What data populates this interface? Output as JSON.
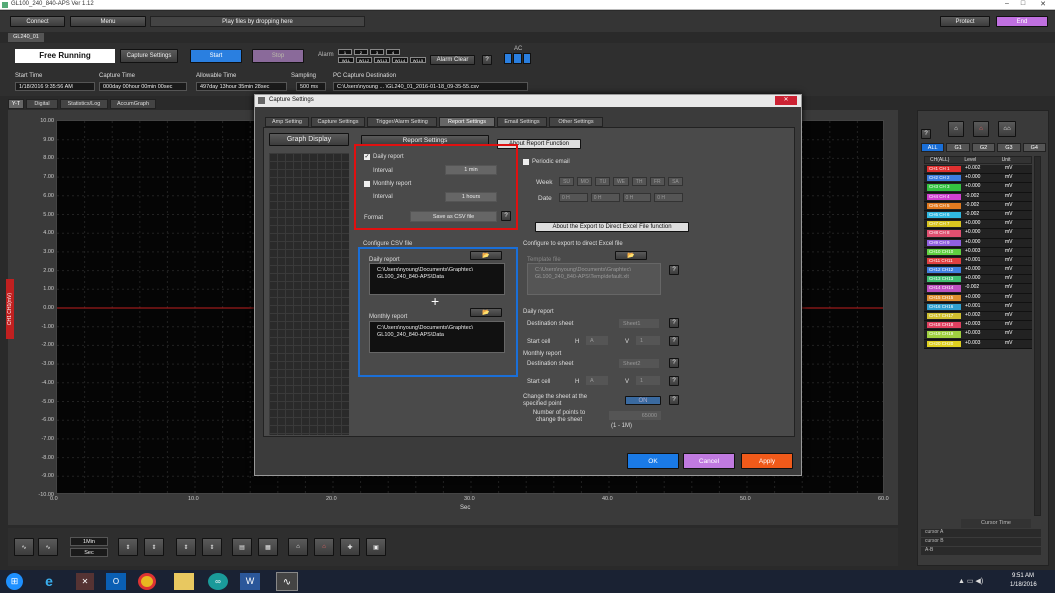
{
  "window": {
    "title": "GL100_240_840-APS Ver 1.12"
  },
  "toolbar": {
    "connect": "Connect",
    "menu": "Menu",
    "drop_hint": "Play files by dropping here",
    "protect": "Protect",
    "end": "End"
  },
  "device_tab": "GL240_01",
  "controls": {
    "mode": "Free Running",
    "capture_settings": "Capture Settings",
    "start": "Start",
    "stop": "Stop",
    "alarm_label": "Alarm",
    "alarm_clear": "Alarm Clear",
    "ac_label": "AC",
    "alarm_ch": [
      "1",
      "2",
      "3",
      "4"
    ],
    "alarm_w": [
      "W1L",
      "W1L2",
      "W1L3",
      "W1L4",
      "W1L5"
    ]
  },
  "status": {
    "start_time_label": "Start Time",
    "start_time": "1/18/2016 9:35:56 AM",
    "capture_time_label": "Capture Time",
    "capture_time": "000day 00hour 00min 00sec",
    "allowable_label": "Allowable Time",
    "allowable": "497day 13hour 35min 28sec",
    "sampling_label": "Sampling",
    "sampling": "500 ms",
    "dest_label": "PC Capture Destination",
    "dest": "C:\\Users\\nyoung ... \\GL240_01_2016-01-18_09-35-55.csv"
  },
  "view_tabs": [
    "Y-T",
    "Digital",
    "Statistics/Log",
    "AccumGraph"
  ],
  "y_axis": [
    "10.00",
    "9.00",
    "8.00",
    "7.00",
    "6.00",
    "5.00",
    "4.00",
    "3.00",
    "2.00",
    "1.00",
    "0.00",
    "-1.00",
    "-2.00",
    "-3.00",
    "-4.00",
    "-5.00",
    "-6.00",
    "-7.00",
    "-8.00",
    "-9.00",
    "-10.00"
  ],
  "x_axis": [
    "0.0",
    "10.0",
    "20.0",
    "30.0",
    "40.0",
    "50.0",
    "60.0"
  ],
  "x_unit": "Sec",
  "channel_axis_label": "CH1 CH1(mV)",
  "bottom": {
    "time_value": "1Min",
    "time_unit": "Sec"
  },
  "right_panel": {
    "groups": [
      "ALL",
      "G1",
      "G2",
      "G3",
      "G4"
    ],
    "headers": [
      "CH(ALL)",
      "Level",
      "Unit"
    ],
    "channels": [
      {
        "name": "CH1 CH 1",
        "value": "+0.002",
        "unit": "mV",
        "color": "#e03030"
      },
      {
        "name": "CH2 CH 2",
        "value": "+0.000",
        "unit": "mV",
        "color": "#3c7de0"
      },
      {
        "name": "CH3 CH 3",
        "value": "+0.000",
        "unit": "mV",
        "color": "#34c240"
      },
      {
        "name": "CH4 CH 4",
        "value": "-0.002",
        "unit": "mV",
        "color": "#d040d0"
      },
      {
        "name": "CH5 CH 5",
        "value": "-0.002",
        "unit": "mV",
        "color": "#e07a20"
      },
      {
        "name": "CH6 CH 6",
        "value": "-0.002",
        "unit": "mV",
        "color": "#30b8e0"
      },
      {
        "name": "CH7 CH 7",
        "value": "+0.000",
        "unit": "mV",
        "color": "#d8c420"
      },
      {
        "name": "CH8 CH 8",
        "value": "+0.000",
        "unit": "mV",
        "color": "#e05070"
      },
      {
        "name": "CH9 CH 9",
        "value": "+0.000",
        "unit": "mV",
        "color": "#9060e0"
      },
      {
        "name": "CH10 CH10",
        "value": "+0.003",
        "unit": "mV",
        "color": "#60d040"
      },
      {
        "name": "CH11 CH11",
        "value": "+0.001",
        "unit": "mV",
        "color": "#e04040"
      },
      {
        "name": "CH12 CH12",
        "value": "+0.000",
        "unit": "mV",
        "color": "#4080e0"
      },
      {
        "name": "CH13 CH13",
        "value": "+0.000",
        "unit": "mV",
        "color": "#40c070"
      },
      {
        "name": "CH14 CH14",
        "value": "-0.002",
        "unit": "mV",
        "color": "#c050c0"
      },
      {
        "name": "CH15 CH15",
        "value": "+0.000",
        "unit": "mV",
        "color": "#e09030"
      },
      {
        "name": "CH16 CH16",
        "value": "+0.001",
        "unit": "mV",
        "color": "#30a0d0"
      },
      {
        "name": "CH17 CH17",
        "value": "+0.002",
        "unit": "mV",
        "color": "#d0c030"
      },
      {
        "name": "CH18 CH18",
        "value": "+0.003",
        "unit": "mV",
        "color": "#e04060"
      },
      {
        "name": "CH19 CH19",
        "value": "+0.003",
        "unit": "mV",
        "color": "#a0d040"
      },
      {
        "name": "CH20 CH20",
        "value": "+0.003",
        "unit": "mV",
        "color": "#e0d020"
      }
    ],
    "cursor_time": "Cursor Time",
    "cursor_rows": [
      "cursor A",
      "cursor B",
      "A-B"
    ]
  },
  "dialog": {
    "title": "Capture Settings",
    "tabs": [
      "Amp Setting",
      "Capture Settings",
      "Trigger/Alarm Setting",
      "Report Settings",
      "Email Settings",
      "Other Settings"
    ],
    "graph_display": "Graph Display",
    "report_settings": "Report Settings",
    "about_report": "About Report Function",
    "daily_report": "Daily report",
    "interval": "Interval",
    "daily_interval": "1 min",
    "monthly_report": "Monthly report",
    "monthly_interval": "1 hours",
    "format": "Format",
    "format_value": "Save as CSV file",
    "periodic_email": "Periodic email",
    "week": "Week",
    "weekdays": [
      "SU",
      "MO",
      "TU",
      "WE",
      "TH",
      "FR",
      "SA"
    ],
    "date": "Date",
    "date_cells": [
      "0 H",
      "0 H",
      "0 H",
      "0 H"
    ],
    "about_excel": "About the Export to Direct Excel File function",
    "configure_csv": "Configure CSV file",
    "csv_daily": "Daily report",
    "csv_daily_path": "C:\\Users\\nyoung\\Documents\\Graphtec\\ GL100_240_840-APS\\Data",
    "csv_monthly": "Monthly report",
    "csv_monthly_path": "C:\\Users\\nyoung\\Documents\\Graphtec\\ GL100_240_840-APS\\Data",
    "configure_excel": "Configure to export to direct Excel file",
    "template_file": "Template file",
    "template_path": "C:\\Users\\nyoung\\Documents\\Graphtec\\ GL100_240_840-APS\\Temp\\default.xlt",
    "xl_daily": "Daily report",
    "dest_sheet": "Destination sheet",
    "daily_sheet": "Sheet1",
    "start_cell": "Start cell",
    "h": "H",
    "v": "V",
    "h_val": "A",
    "v_val": "1",
    "xl_monthly": "Monthly report",
    "monthly_sheet": "Sheet2",
    "change_sheet": "Change the sheet at the specified point",
    "change_value": "ON",
    "num_points": "Number of points to change the sheet",
    "num_points_value": "65000",
    "range": "(1 - 1M)",
    "ok": "OK",
    "cancel": "Cancel",
    "apply": "Apply"
  },
  "taskbar": {
    "time": "9:51 AM",
    "date": "1/18/2016"
  }
}
